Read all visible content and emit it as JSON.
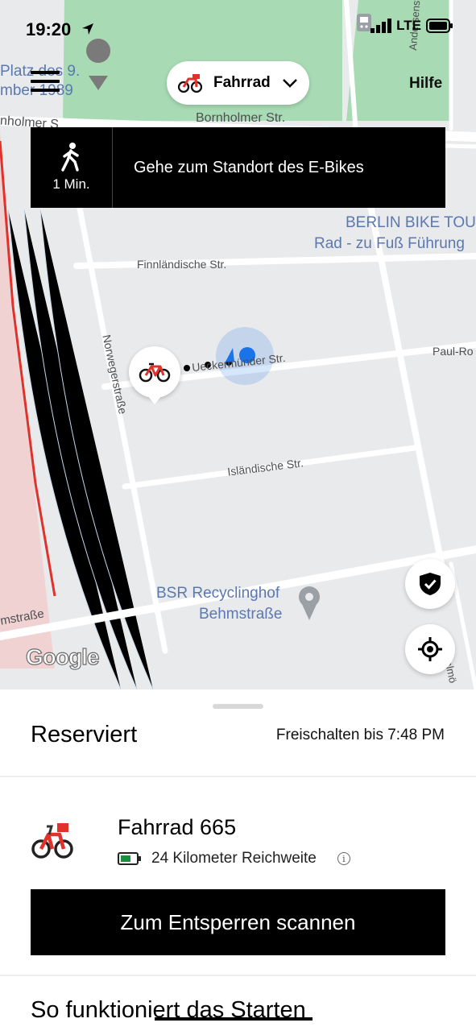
{
  "status_bar": {
    "time": "19:20",
    "network": "LTE"
  },
  "header": {
    "mode_label": "Fahrrad",
    "help_label": "Hilfe"
  },
  "navigation": {
    "walk_time": "1 Min.",
    "instruction": "Gehe zum Standort des E-Bikes"
  },
  "map": {
    "streets": {
      "bornholmer": "Bornholmer Str.",
      "finnlaendische": "Finnländische Str.",
      "norweger": "Norwegerstraße",
      "ueckermuender": "Ueckermünder Str.",
      "islaendische": "Isländische Str.",
      "paul": "Paul-Ro",
      "andersen": "Andersenstraße",
      "behm": "mstraße",
      "malmoe": "Malmö",
      "platz1": "Platz des 9.",
      "platz2": "mber 1989",
      "bornholm_left": "nholmer S"
    },
    "pois": {
      "tour_line1": "BERLIN BIKE TOU",
      "tour_line2": "Rad - zu Fuß Führung",
      "bsr_line1": "BSR Recyclinghof",
      "bsr_line2": "Behmstraße"
    },
    "attribution": "Google"
  },
  "reservation": {
    "status": "Reserviert",
    "unlock_until": "Freischalten bis 7:48 PM",
    "vehicle_name": "Fahrrad 665",
    "range": "24 Kilometer Reichweite",
    "scan_button": "Zum Entsperren scannen",
    "how_to_title": "So funktioniert das Starten"
  },
  "colors": {
    "accent_red": "#e0322b",
    "park_green": "#a8dbb4",
    "location_blue": "#1a73e8",
    "battery_green": "#1e8e3e"
  }
}
